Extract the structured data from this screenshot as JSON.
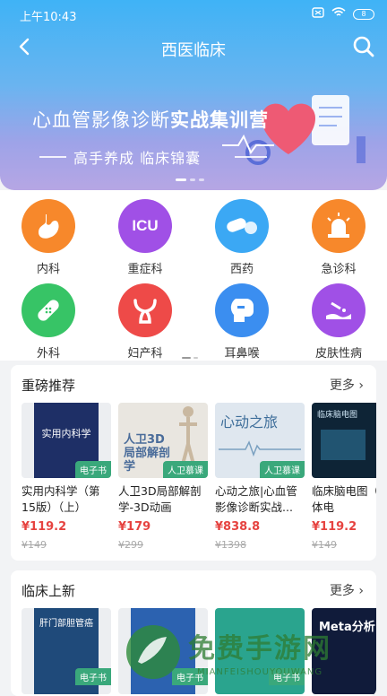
{
  "status": {
    "time": "上午10:43",
    "battery": "8"
  },
  "nav": {
    "title": "西医临床"
  },
  "banner": {
    "title_plain": "心血管影像诊断",
    "title_bold": "实战集训营",
    "subtitle": "高手养成  临床锦囊"
  },
  "categories": [
    {
      "label": "内科",
      "icon": "stomach-icon",
      "color": "#f7882b"
    },
    {
      "label": "重症科",
      "icon": "icu-icon",
      "color": "#a050e6"
    },
    {
      "label": "西药",
      "icon": "pill-icon",
      "color": "#3ba8f4"
    },
    {
      "label": "急诊科",
      "icon": "siren-icon",
      "color": "#f7882b"
    },
    {
      "label": "外科",
      "icon": "bandage-icon",
      "color": "#37c466"
    },
    {
      "label": "妇产科",
      "icon": "uterus-icon",
      "color": "#ee4a48"
    },
    {
      "label": "耳鼻喉",
      "icon": "ent-icon",
      "color": "#3b8ef0"
    },
    {
      "label": "皮肤性病",
      "icon": "skin-icon",
      "color": "#a050e6"
    }
  ],
  "section1": {
    "title": "重磅推荐",
    "more": "更多",
    "books": [
      {
        "title": "实用内科学（第15版）（上）",
        "price": "¥119.2",
        "orig": "¥149",
        "tag": "电子书",
        "cover_text": "实用内科学"
      },
      {
        "title": "人卫3D局部解剖学-3D动画",
        "price": "¥179",
        "orig": "¥299",
        "tag": "人卫慕课",
        "cover_text": "人卫3D 局部解剖学"
      },
      {
        "title": "心动之旅|心血管影像诊断实战...",
        "price": "¥838.8",
        "orig": "¥1398",
        "tag": "人卫慕课",
        "cover_text": "心动之旅"
      },
      {
        "title": "临床脑电图（富媒体电",
        "price": "¥119.2",
        "orig": "¥149",
        "tag": "",
        "cover_text": "临床脑电图"
      }
    ]
  },
  "section2": {
    "title": "临床上新",
    "more": "更多",
    "books": [
      {
        "tag": "电子书",
        "cover_text": "肝门部胆管癌"
      },
      {
        "tag": "电子书",
        "cover_text": ""
      },
      {
        "tag": "电子书",
        "cover_text": ""
      },
      {
        "tag": "",
        "cover_text": "Meta分析"
      }
    ]
  },
  "watermark": {
    "text": "免费手游网",
    "sub": "MIANFEISHOUYOUWANG"
  }
}
